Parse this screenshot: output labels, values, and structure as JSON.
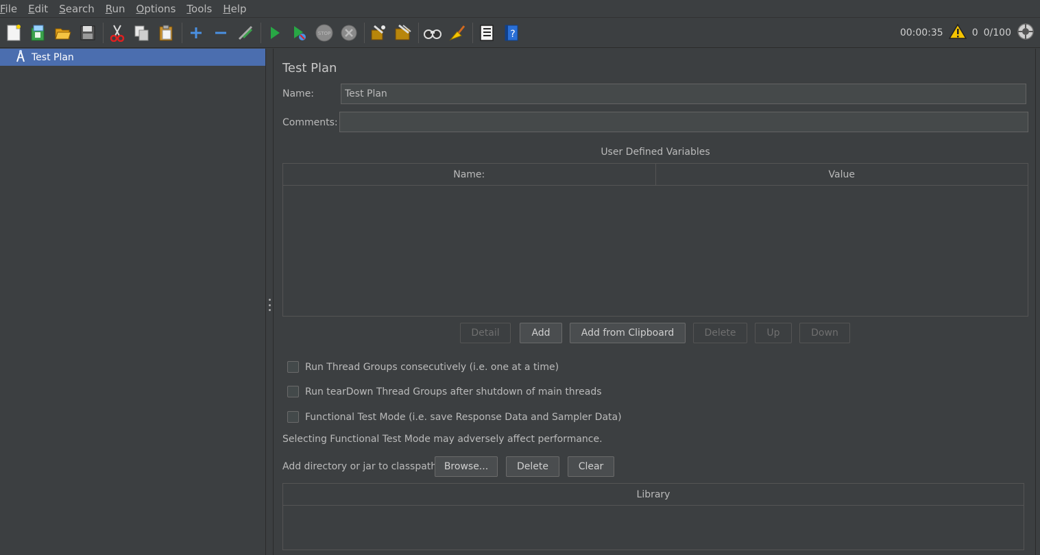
{
  "menu": [
    {
      "label": "File",
      "mnemonic": "F",
      "rest": "ile"
    },
    {
      "label": "Edit",
      "mnemonic": "E",
      "rest": "dit"
    },
    {
      "label": "Search",
      "mnemonic": "S",
      "rest": "earch"
    },
    {
      "label": "Run",
      "mnemonic": "R",
      "rest": "un"
    },
    {
      "label": "Options",
      "mnemonic": "O",
      "rest": "ptions"
    },
    {
      "label": "Tools",
      "mnemonic": "T",
      "rest": "ools"
    },
    {
      "label": "Help",
      "mnemonic": "H",
      "rest": "elp"
    }
  ],
  "toolbar": {
    "icons": [
      "new-icon",
      "templates-icon",
      "open-icon",
      "save-icon",
      "cut-icon",
      "copy-icon",
      "paste-icon",
      "expand-icon",
      "collapse-icon",
      "toggle-icon",
      "start-icon",
      "start-no-pauses-icon",
      "stop-icon",
      "shutdown-icon",
      "clear-icon",
      "clear-all-icon",
      "search-icon",
      "reset-search-icon",
      "function-helper-icon",
      "help-icon"
    ],
    "timer": "00:00:35",
    "warnings": "0",
    "threads": "0/100"
  },
  "tree": {
    "selected_item": "Test Plan"
  },
  "test_plan": {
    "title": "Test Plan",
    "name_label": "Name:",
    "name_value": "Test Plan",
    "comments_label": "Comments:",
    "comments_value": "",
    "udv_title": "User Defined Variables",
    "udv_columns": [
      "Name:",
      "Value"
    ],
    "buttons": {
      "detail": "Detail",
      "add": "Add",
      "add_clipboard": "Add from Clipboard",
      "delete": "Delete",
      "up": "Up",
      "down": "Down"
    },
    "checkboxes": [
      "Run Thread Groups consecutively (i.e. one at a time)",
      "Run tearDown Thread Groups after shutdown of main threads",
      "Functional Test Mode (i.e. save Response Data and Sampler Data)"
    ],
    "functional_note": "Selecting Functional Test Mode may adversely affect performance.",
    "classpath_label": "Add directory or jar to classpath",
    "classpath_buttons": {
      "browse": "Browse...",
      "delete": "Delete",
      "clear": "Clear"
    },
    "library_column": "Library"
  }
}
